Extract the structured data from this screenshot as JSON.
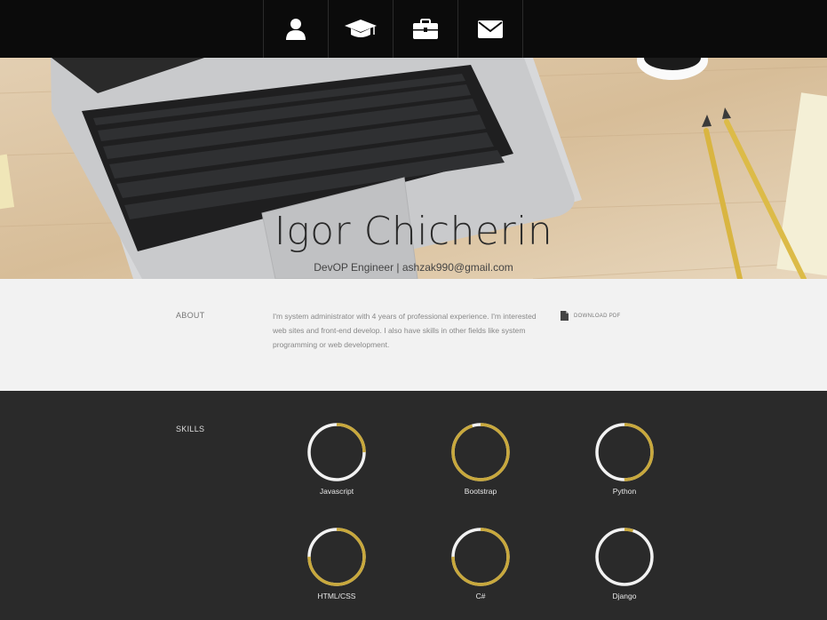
{
  "nav": {
    "items": [
      {
        "icon": "user-icon"
      },
      {
        "icon": "graduation-cap-icon"
      },
      {
        "icon": "briefcase-icon"
      },
      {
        "icon": "envelope-icon"
      }
    ]
  },
  "hero": {
    "name": "Igor Chicherin",
    "subtitle": "DevOP Engineer | ashzak990@gmail.com"
  },
  "about": {
    "label": "ABOUT",
    "text": "I'm system administrator with 4 years of professional experience. I'm interested web sites and front-end develop. I also have skills in other fields like system programming or web development.",
    "download_label": "DOWNLOAD PDF",
    "download_icon": "file-icon"
  },
  "skills": {
    "label": "SKILLS",
    "items": [
      {
        "name": "Javascript",
        "level": 0.25
      },
      {
        "name": "Bootstrap",
        "level": 0.95
      },
      {
        "name": "Python",
        "level": 0.5
      },
      {
        "name": "HTML/CSS",
        "level": 0.75
      },
      {
        "name": "C#",
        "level": 0.75
      },
      {
        "name": "Django",
        "level": 0.05
      }
    ],
    "colors": {
      "fill": "#c8a83c",
      "track": "#f2f2f2"
    }
  }
}
